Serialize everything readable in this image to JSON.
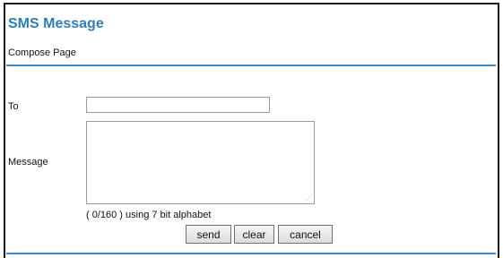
{
  "header": {
    "title": "SMS Message",
    "subtitle": "Compose Page"
  },
  "form": {
    "to_label": "To",
    "to_value": "",
    "message_label": "Message",
    "message_value": "",
    "counter_text": "( 0/160 ) using 7 bit alphabet"
  },
  "buttons": {
    "send": "send",
    "clear": "clear",
    "cancel": "cancel"
  },
  "colors": {
    "accent": "#2e7fb8",
    "rule": "#3a8fc8"
  }
}
